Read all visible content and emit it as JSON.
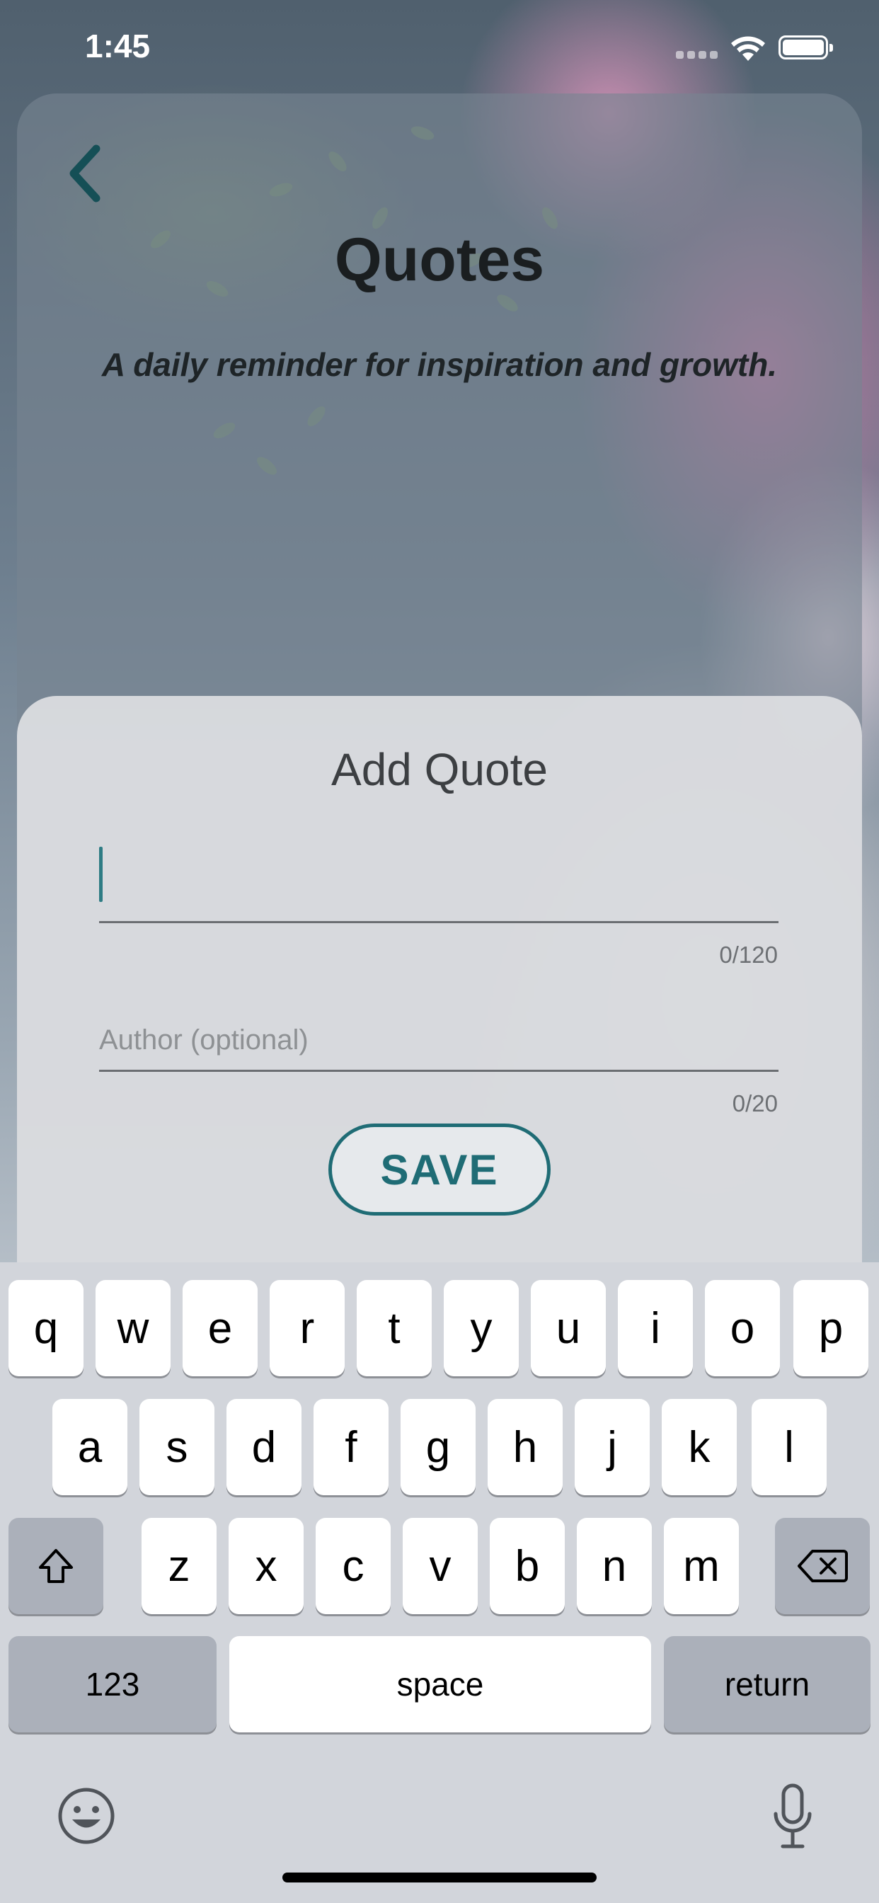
{
  "status_bar": {
    "time": "1:45",
    "icons": [
      "signal-icon",
      "wifi-icon",
      "battery-icon"
    ]
  },
  "header": {
    "title": "Quotes",
    "subtitle": "A daily reminder for inspiration and growth.",
    "back_icon": "chevron-left-icon"
  },
  "add_quote_sheet": {
    "title": "Add Quote",
    "quote_field": {
      "value": "",
      "placeholder": "",
      "counter": "0/120"
    },
    "author_field": {
      "value": "",
      "placeholder": "Author (optional)",
      "counter": "0/20"
    },
    "save_label": "SAVE"
  },
  "keyboard": {
    "row1": [
      "q",
      "w",
      "e",
      "r",
      "t",
      "y",
      "u",
      "i",
      "o",
      "p"
    ],
    "row2": [
      "a",
      "s",
      "d",
      "f",
      "g",
      "h",
      "j",
      "k",
      "l"
    ],
    "row3": [
      "z",
      "x",
      "c",
      "v",
      "b",
      "n",
      "m"
    ],
    "numbers_label": "123",
    "space_label": "space",
    "return_label": "return",
    "icons": [
      "shift-icon",
      "backspace-icon",
      "emoji-icon",
      "microphone-icon"
    ]
  },
  "colors": {
    "accent": "#1f6c75",
    "caret": "#2e7c84",
    "sheet_bg": "#dedfe2",
    "keyboard_bg": "#d2d5db"
  }
}
